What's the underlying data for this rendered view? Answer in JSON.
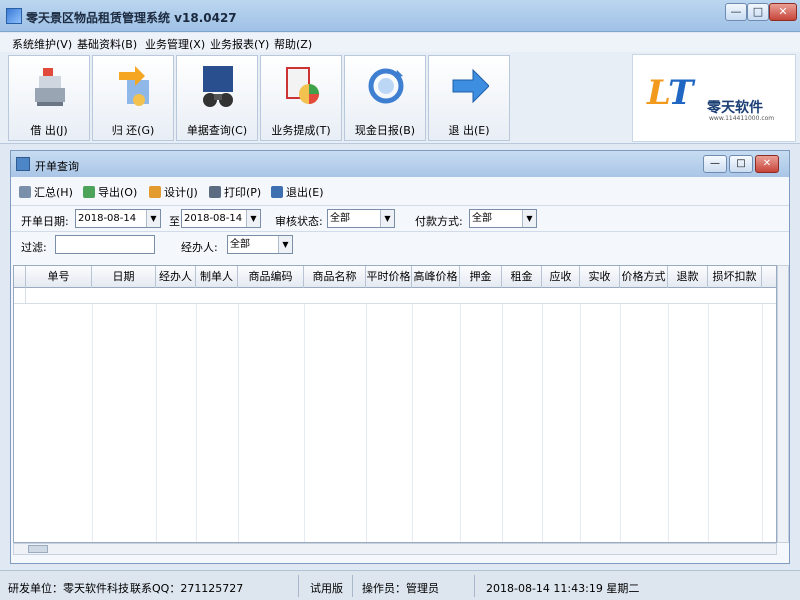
{
  "window": {
    "title": "零天景区物品租赁管理系统  v18.0427",
    "min": "—",
    "max": "□",
    "close": "✕"
  },
  "menu": [
    "系统维护(V)",
    "基础资料(B)",
    "业务管理(X)",
    "业务报表(Y)",
    "帮助(Z)"
  ],
  "toolbar": [
    {
      "label": "借 出(J)",
      "icon": "cash-register-icon"
    },
    {
      "label": "归 还(G)",
      "icon": "return-arrow-icon"
    },
    {
      "label": "单据查询(C)",
      "icon": "binoculars-icon"
    },
    {
      "label": "业务提成(T)",
      "icon": "pie-chart-icon"
    },
    {
      "label": "现金日报(B)",
      "icon": "cycle-icon"
    },
    {
      "label": "退 出(E)",
      "icon": "exit-arrow-icon"
    }
  ],
  "logo": {
    "mark_a": "L",
    "mark_b": "T",
    "name": "零天软件",
    "url": "www.114411000.com"
  },
  "child": {
    "title": "开单查询",
    "actions": [
      {
        "label": "汇总(H)",
        "icon": "sum-icon"
      },
      {
        "label": "导出(O)",
        "icon": "export-icon"
      },
      {
        "label": "设计(J)",
        "icon": "design-icon"
      },
      {
        "label": "打印(P)",
        "icon": "printer-icon"
      },
      {
        "label": "退出(E)",
        "icon": "exit-icon"
      }
    ],
    "filters": {
      "date_label": "开单日期:",
      "date_from": "2018-08-14",
      "to_label": "至",
      "date_to": "2018-08-14",
      "audit_label": "审核状态:",
      "audit_value": "全部",
      "pay_label": "付款方式:",
      "pay_value": "全部",
      "filter_label": "过滤:",
      "filter_value": "",
      "handler_label": "经办人:",
      "handler_value": "全部"
    },
    "columns": [
      "单号",
      "日期",
      "经办人",
      "制单人",
      "商品编码",
      "商品名称",
      "平时价格",
      "高峰价格",
      "押金",
      "租金",
      "应收",
      "实收",
      "价格方式",
      "退款",
      "损坏扣款"
    ]
  },
  "status": {
    "company": "研发单位：零天软件科技",
    "qq": "联系QQ：271125727",
    "edition": "试用版",
    "operator": "操作员：管理员",
    "datetime": "2018-08-14 11:43:19 星期二"
  }
}
